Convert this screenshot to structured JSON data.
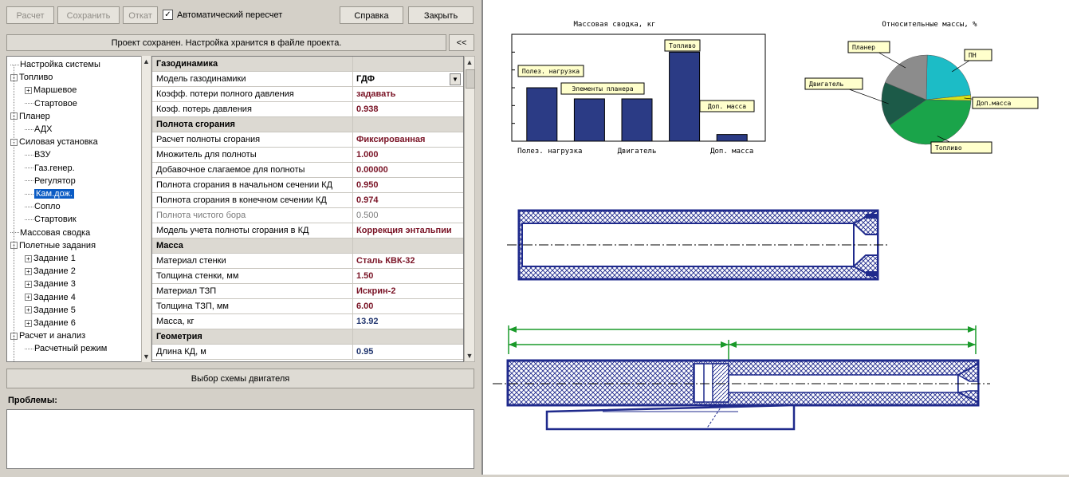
{
  "toolbar": {
    "calc": "Расчет",
    "save": "Сохранить",
    "rollback": "Откат",
    "autocalc": "Автоматический пересчет",
    "help": "Справка",
    "close": "Закрыть",
    "collapse": "<<"
  },
  "status": "Проект сохранен. Настройка хранится в файле проекта.",
  "tree": [
    {
      "label": "Настройка системы",
      "level": 0,
      "expander": ""
    },
    {
      "label": "Топливо",
      "level": 0,
      "expander": "-"
    },
    {
      "label": "Маршевое",
      "level": 1,
      "expander": "+"
    },
    {
      "label": "Стартовое",
      "level": 1,
      "expander": ""
    },
    {
      "label": "Планер",
      "level": 0,
      "expander": "-"
    },
    {
      "label": "АДХ",
      "level": 1,
      "expander": ""
    },
    {
      "label": "Силовая установка",
      "level": 0,
      "expander": "-"
    },
    {
      "label": "ВЗУ",
      "level": 1,
      "expander": ""
    },
    {
      "label": "Газ.генер.",
      "level": 1,
      "expander": ""
    },
    {
      "label": "Регулятор",
      "level": 1,
      "expander": ""
    },
    {
      "label": "Кам.дож.",
      "level": 1,
      "expander": "",
      "selected": true
    },
    {
      "label": "Сопло",
      "level": 1,
      "expander": ""
    },
    {
      "label": "Стартовик",
      "level": 1,
      "expander": ""
    },
    {
      "label": "Массовая сводка",
      "level": 0,
      "expander": ""
    },
    {
      "label": "Полетные задания",
      "level": 0,
      "expander": "-"
    },
    {
      "label": "Задание 1",
      "level": 1,
      "expander": "+"
    },
    {
      "label": "Задание 2",
      "level": 1,
      "expander": "+"
    },
    {
      "label": "Задание 3",
      "level": 1,
      "expander": "+"
    },
    {
      "label": "Задание 4",
      "level": 1,
      "expander": "+"
    },
    {
      "label": "Задание 5",
      "level": 1,
      "expander": "+"
    },
    {
      "label": "Задание 6",
      "level": 1,
      "expander": "+"
    },
    {
      "label": "Расчет и анализ",
      "level": 0,
      "expander": "-"
    },
    {
      "label": "Расчетный режим",
      "level": 1,
      "expander": ""
    }
  ],
  "properties": [
    {
      "name": "Газодинамика",
      "section": true
    },
    {
      "name": "Модель газодинамики",
      "value": "ГДФ",
      "style": "plain",
      "dropdown": true
    },
    {
      "name": "Коэфф. потери полного давления",
      "value": "задавать",
      "style": "dark"
    },
    {
      "name": "Коэф. потерь давления",
      "value": "0.938",
      "style": "dark"
    },
    {
      "name": "Полнота сгорания",
      "section": true
    },
    {
      "name": "Расчет полноты сгорания",
      "value": "Фиксированная",
      "style": "dark"
    },
    {
      "name": "Множитель для полноты",
      "value": "1.000",
      "style": "dark"
    },
    {
      "name": "Добавочное слагаемое для полноты",
      "value": "0.00000",
      "style": "dark"
    },
    {
      "name": "Полнота сгорания в начальном сечении КД",
      "value": "0.950",
      "style": "dark"
    },
    {
      "name": "Полнота сгорания в конечном сечении КД",
      "value": "0.974",
      "style": "dark"
    },
    {
      "name": "Полнота чистого бора",
      "value": "0.500",
      "style": "grey",
      "greyName": true
    },
    {
      "name": "Модель учета полноты сгорания в КД",
      "value": "Коррекция энтальпии",
      "style": "dark"
    },
    {
      "name": "Масса",
      "section": true
    },
    {
      "name": "Материал стенки",
      "value": "Сталь КВК-32",
      "style": "dark"
    },
    {
      "name": "Толщина стенки, мм",
      "value": "1.50",
      "style": "dark"
    },
    {
      "name": "Материал ТЗП",
      "value": "Искрин-2",
      "style": "dark"
    },
    {
      "name": "Толщина ТЗП, мм",
      "value": "6.00",
      "style": "dark"
    },
    {
      "name": "Масса, кг",
      "value": "13.92",
      "style": "blue"
    },
    {
      "name": "Геометрия",
      "section": true
    },
    {
      "name": "Длина КД, м",
      "value": "0.95",
      "style": "blue"
    }
  ],
  "scheme_button": "Выбор схемы двигателя",
  "problems_label": "Проблемы:",
  "colors": {
    "bar": "#2b3b85",
    "drawing": "#1f2a8c",
    "dim": "#1a9a2a",
    "selection": "#0a5bc4"
  },
  "chart_data": [
    {
      "type": "bar",
      "title": "Массовая сводка, кг",
      "categories": [
        "Полез. нагрузка",
        "Элементы планера",
        "Двигатель",
        "Топливо",
        "Доп. масса"
      ],
      "tick_labels": [
        "Полез. нагрузка",
        "Двигатель",
        "Доп. масса"
      ],
      "values": [
        24,
        19,
        19,
        40,
        3
      ],
      "ylim": [
        0,
        48
      ],
      "grid": true,
      "callouts": [
        "Полез. нагрузка",
        "Элементы планера",
        "Топливо",
        "Доп. масса"
      ]
    },
    {
      "type": "pie",
      "title": "Относительные массы, %",
      "labels": [
        "ПН",
        "Доп.масса",
        "Топливо",
        "Двигатель",
        "Планер"
      ],
      "values": [
        23,
        2,
        40,
        16,
        19
      ],
      "colors": [
        "#1cbcc6",
        "#d9e21a",
        "#1aa44a",
        "#1c5a48",
        "#8c8c8c"
      ]
    }
  ]
}
